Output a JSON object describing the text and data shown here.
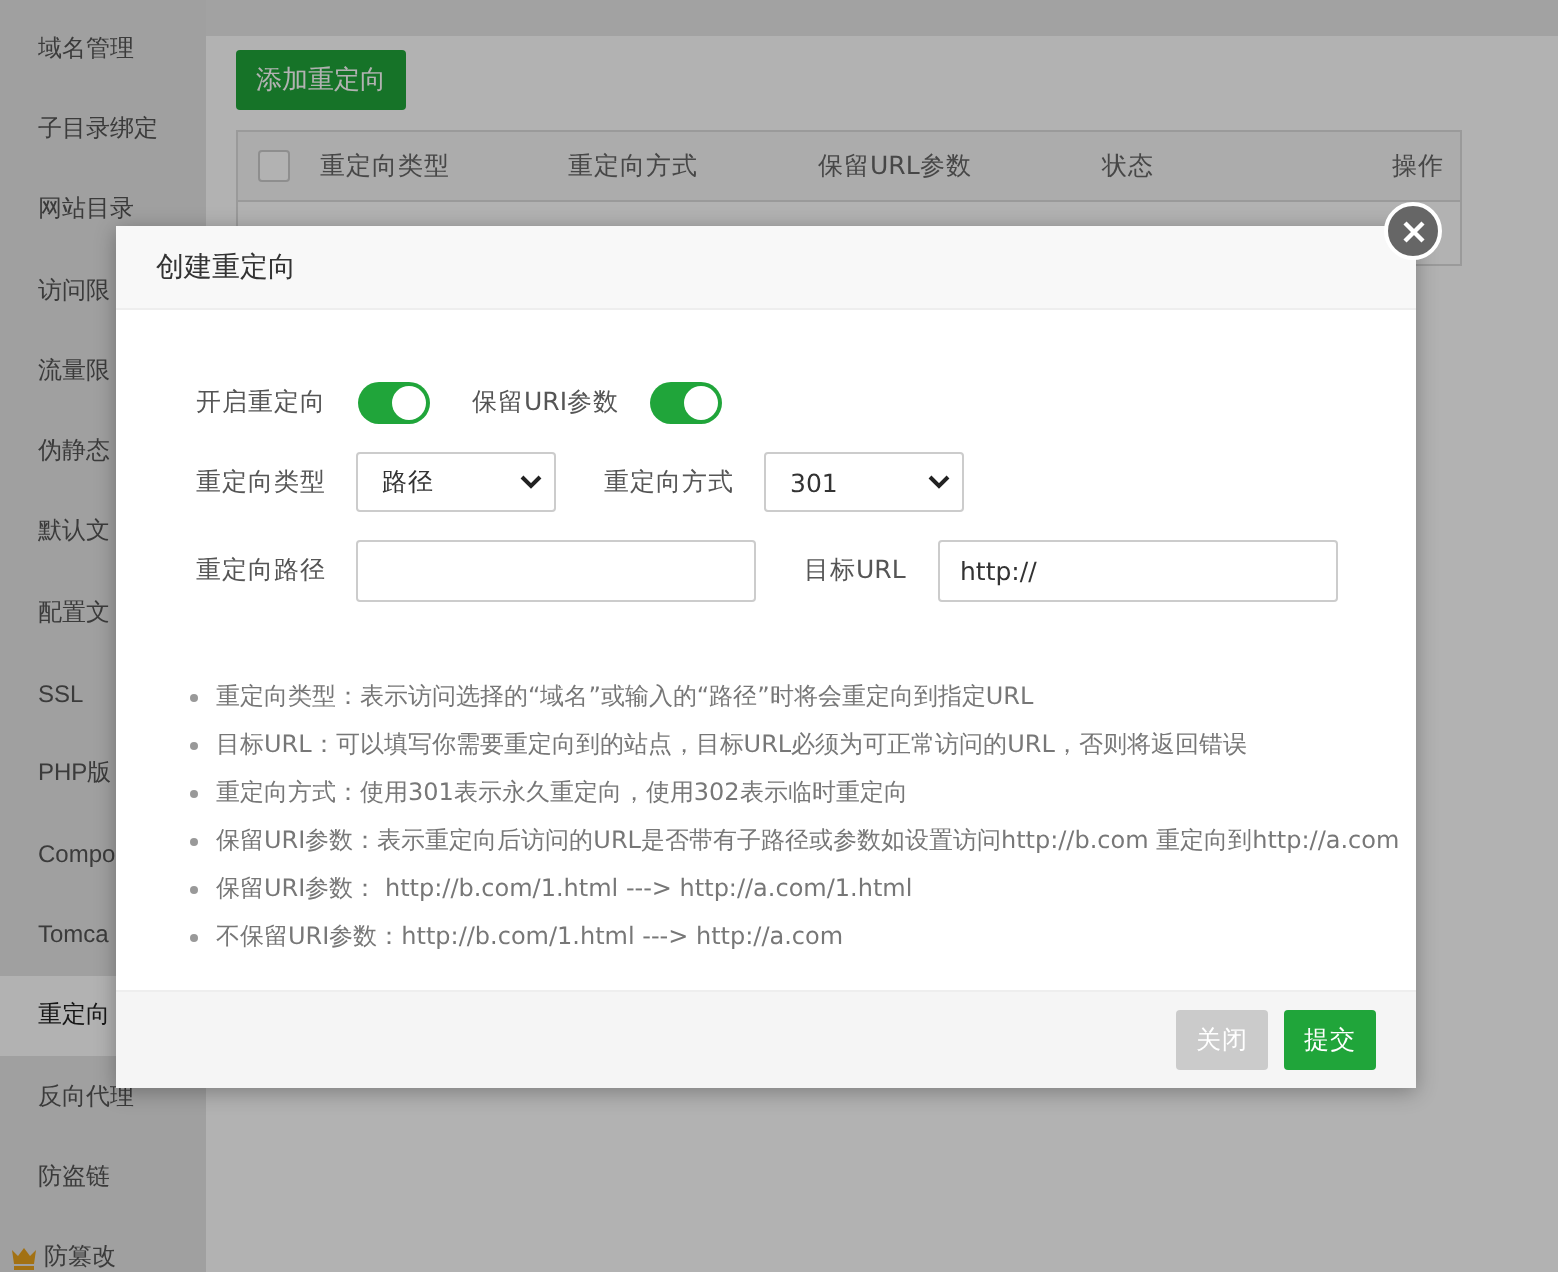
{
  "sidebar": {
    "items": [
      {
        "label": "域名管理",
        "selected": false,
        "kind": "plain"
      },
      {
        "label": "子目录绑定",
        "selected": false,
        "kind": "plain"
      },
      {
        "label": "网站目录",
        "selected": false,
        "kind": "plain"
      },
      {
        "label": "访问限",
        "selected": false,
        "kind": "plain"
      },
      {
        "label": "流量限",
        "selected": false,
        "kind": "plain"
      },
      {
        "label": "伪静态",
        "selected": false,
        "kind": "plain"
      },
      {
        "label": "默认文",
        "selected": false,
        "kind": "plain"
      },
      {
        "label": "配置文",
        "selected": false,
        "kind": "plain"
      },
      {
        "label": "SSL",
        "selected": false,
        "kind": "plain"
      },
      {
        "label": "PHP版",
        "selected": false,
        "kind": "plain"
      },
      {
        "label": "Compo",
        "selected": false,
        "kind": "plain"
      },
      {
        "label": "Tomca",
        "selected": false,
        "kind": "plain"
      },
      {
        "label": "重定向",
        "selected": true,
        "kind": "plain"
      },
      {
        "label": "反向代理",
        "selected": false,
        "kind": "plain"
      },
      {
        "label": "防盗链",
        "selected": false,
        "kind": "plain"
      },
      {
        "label": "防篡改",
        "selected": false,
        "kind": "premium"
      }
    ]
  },
  "add_button": "添加重定向",
  "table": {
    "columns": [
      "重定向类型",
      "重定向方式",
      "保留URL参数",
      "状态",
      "操作"
    ],
    "select_all": {
      "checked": false
    }
  },
  "dialog": {
    "title": "创建重定向",
    "toggles": [
      {
        "label": "开启重定向",
        "on": true
      },
      {
        "label": "保留URI参数",
        "on": true
      }
    ],
    "selects": [
      {
        "label": "重定向类型",
        "value": "路径"
      },
      {
        "label": "重定向方式",
        "value": "301"
      }
    ],
    "fields": [
      {
        "label": "重定向路径"
      },
      {
        "label": "目标URL",
        "value": "http://"
      }
    ],
    "notes": [
      "重定向类型：表示访问选择的“域名”或输入的“路径”时将会重定向到指定URL",
      "目标URL：可以填写你需要重定向到的站点，目标URL必须为可正常访问的URL，否则将返回错误",
      "重定向方式：使用301表示永久重定向，使用302表示临时重定向",
      "保留URI参数：表示重定向后访问的URL是否带有子路径或参数如设置访问http://b.com 重定向到http://a.com",
      "保留URI参数： http://b.com/1.html ---> http://a.com/1.html",
      "不保留URI参数：http://b.com/1.html ---> http://a.com"
    ],
    "buttons": [
      {
        "label": "关闭",
        "disabled": true
      },
      {
        "label": "提交",
        "disabled": false
      }
    ]
  }
}
